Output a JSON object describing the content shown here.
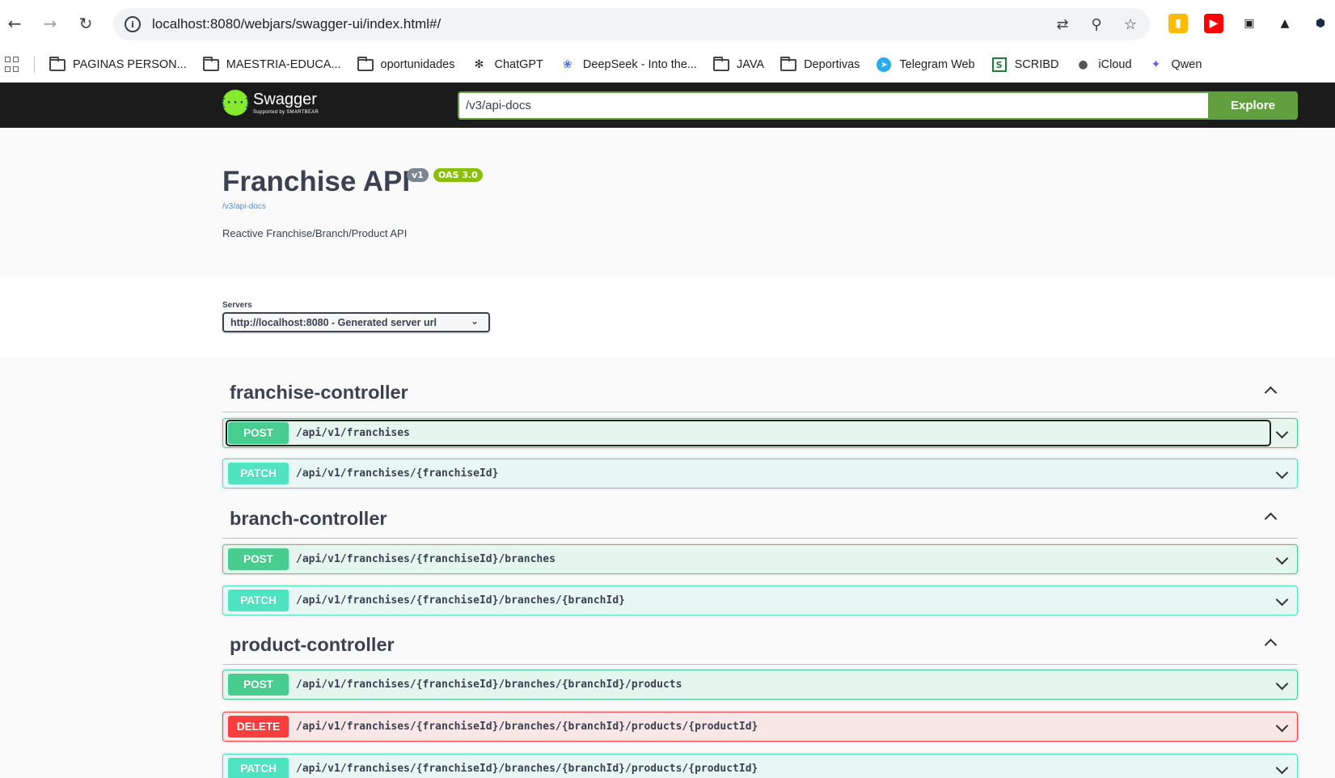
{
  "browser": {
    "url": "localhost:8080/webjars/swagger-ui/index.html#/",
    "back_icon": "arrow-left",
    "forward_icon": "arrow-right",
    "reload_icon": "reload",
    "bookmarks": [
      {
        "label": "PAGINAS PERSON...",
        "icon": "folder"
      },
      {
        "label": "MAESTRIA-EDUCA...",
        "icon": "folder"
      },
      {
        "label": "oportunidades",
        "icon": "folder"
      },
      {
        "label": "ChatGPT",
        "icon": "chatgpt"
      },
      {
        "label": "DeepSeek - Into the...",
        "icon": "deepseek"
      },
      {
        "label": "JAVA",
        "icon": "folder"
      },
      {
        "label": "Deportivas",
        "icon": "folder"
      },
      {
        "label": "Telegram Web",
        "icon": "telegram"
      },
      {
        "label": "SCRIBD",
        "icon": "scribd"
      },
      {
        "label": "iCloud",
        "icon": "apple"
      },
      {
        "label": "Qwen",
        "icon": "qwen"
      }
    ]
  },
  "swagger": {
    "logo_text": "Swagger",
    "logo_sub": "Supported by SMARTBEAR",
    "spec_url": "/v3/api-docs",
    "explore_label": "Explore",
    "brand_green": "#62a03f"
  },
  "info": {
    "title": "Franchise API",
    "version": "v1",
    "oas": "OAS 3.0",
    "spec_link": "/v3/api-docs",
    "description": "Reactive Franchise/Branch/Product API"
  },
  "servers": {
    "label": "Servers",
    "selected": "http://localhost:8080 - Generated server url"
  },
  "tags": [
    {
      "name": "franchise-controller",
      "operations": [
        {
          "method": "POST",
          "path": "/api/v1/franchises"
        },
        {
          "method": "PATCH",
          "path": "/api/v1/franchises/{franchiseId}"
        }
      ]
    },
    {
      "name": "branch-controller",
      "operations": [
        {
          "method": "POST",
          "path": "/api/v1/franchises/{franchiseId}/branches"
        },
        {
          "method": "PATCH",
          "path": "/api/v1/franchises/{franchiseId}/branches/{branchId}"
        }
      ]
    },
    {
      "name": "product-controller",
      "operations": [
        {
          "method": "POST",
          "path": "/api/v1/franchises/{franchiseId}/branches/{branchId}/products"
        },
        {
          "method": "DELETE",
          "path": "/api/v1/franchises/{franchiseId}/branches/{branchId}/products/{productId}"
        },
        {
          "method": "PATCH",
          "path": "/api/v1/franchises/{franchiseId}/branches/{branchId}/products/{productId}"
        }
      ]
    }
  ],
  "colors": {
    "post": "#49cc90",
    "patch": "#50e3c2",
    "delete": "#f93e3e"
  }
}
